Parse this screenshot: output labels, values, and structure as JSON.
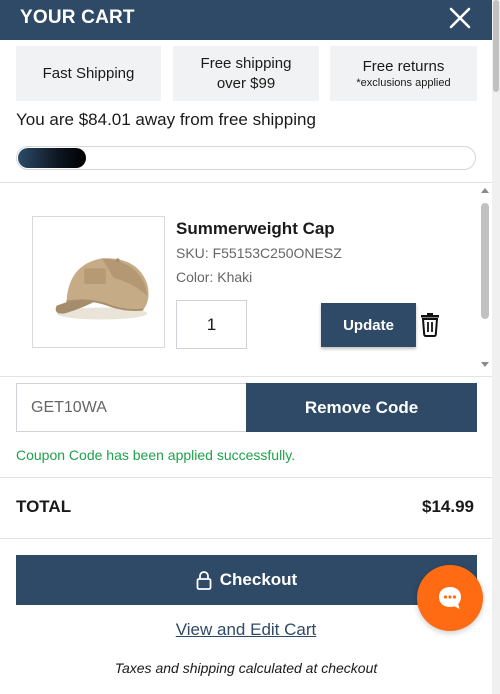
{
  "header": {
    "title": "YOUR CART",
    "close_icon": "close-icon"
  },
  "perks": [
    {
      "main": "Fast Shipping",
      "sub": ""
    },
    {
      "main": "Free shipping over $99",
      "sub": ""
    },
    {
      "main": "Free returns",
      "sub": "*exclusions applied"
    }
  ],
  "shipping": {
    "away_text": "You are $84.01 away from free shipping",
    "progress_fraction": 0.15
  },
  "item": {
    "name": "Summerweight Cap",
    "sku": "SKU: F55153C250ONESZ",
    "color": "Color:  Khaki",
    "quantity": "1",
    "update_label": "Update"
  },
  "coupon": {
    "code": "GET10WA",
    "remove_label": "Remove Code",
    "message": "Coupon Code has been applied successfully."
  },
  "total": {
    "label": "TOTAL",
    "value": "$14.99"
  },
  "checkout_label": "Checkout",
  "view_cart_label": "View and Edit Cart",
  "taxes_note": "Taxes and shipping calculated at checkout",
  "colors": {
    "brand": "#2e4a66",
    "success": "#1ea24a",
    "chat": "#ff6b12"
  }
}
